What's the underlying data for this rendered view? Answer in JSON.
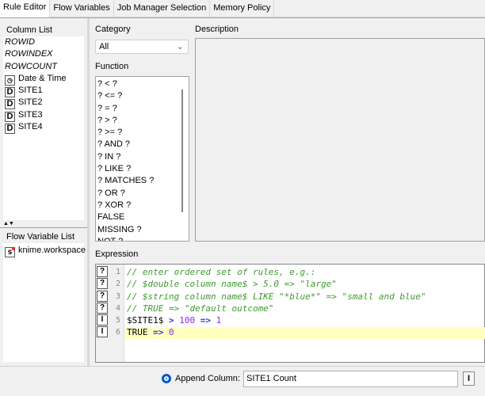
{
  "tabs": [
    "Rule Editor",
    "Flow Variables",
    "Job Manager Selection",
    "Memory Policy"
  ],
  "column_list": {
    "label": "Column List",
    "special": [
      "ROWID",
      "ROWINDEX",
      "ROWCOUNT"
    ],
    "date_time": "Date & Time",
    "columns": [
      "SITE1",
      "SITE2",
      "SITE3",
      "SITE4"
    ],
    "column_type_icon": "D"
  },
  "flow_variable_list": {
    "label": "Flow Variable List",
    "items": [
      "knime.workspace"
    ],
    "type_icon": "s"
  },
  "category": {
    "label": "Category",
    "value": "All"
  },
  "function": {
    "label": "Function",
    "items": [
      "? < ?",
      "? <= ?",
      "? = ?",
      "? > ?",
      "? >= ?",
      "? AND ?",
      "? IN ?",
      "? LIKE ?",
      "? MATCHES ?",
      "? OR ?",
      "? XOR ?",
      "FALSE",
      "MISSING ?",
      "NOT ?"
    ]
  },
  "description": {
    "label": "Description"
  },
  "expression": {
    "label": "Expression",
    "gutter": [
      "?",
      "?",
      "?",
      "?",
      "I",
      "I"
    ],
    "line_numbers": [
      "1",
      "2",
      "3",
      "4",
      "5",
      "6"
    ],
    "lines": [
      "// enter ordered set of rules, e.g.:",
      "// $double column name$ > 5.0 => \"large\"",
      "// $string column name$ LIKE \"*blue*\" => \"small and blue\"",
      "// TRUE => \"default outcome\""
    ],
    "rule5": {
      "col": "$SITE1$",
      "op": " > ",
      "val": "100",
      "arrow": " => ",
      "out": "1"
    },
    "rule6": {
      "kw": "TRUE",
      "arrow": " => ",
      "out": "0"
    },
    "highlight_color": "#ffffc0"
  },
  "bottom": {
    "append_label": "Append Column:",
    "append_value": "SITE1 Count",
    "type_button": "I",
    "accent": "#0a5bc4"
  }
}
